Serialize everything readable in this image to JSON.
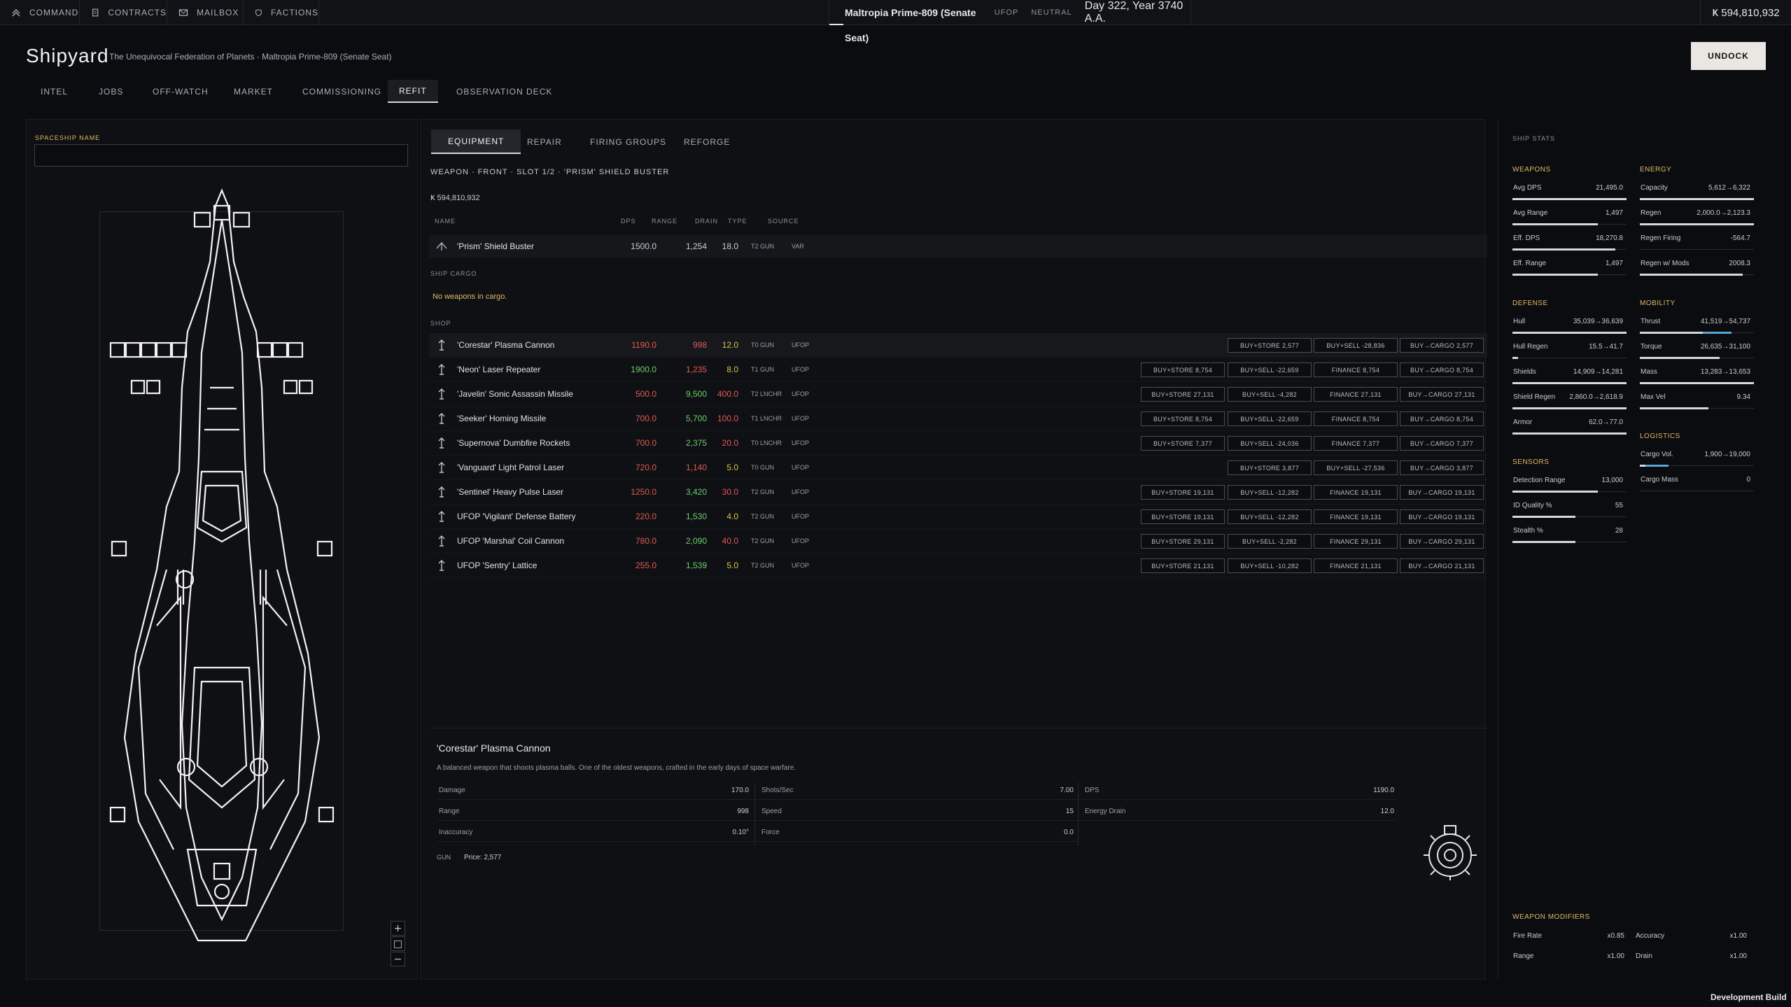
{
  "topbar": {
    "nav": [
      {
        "label": "COMMAND",
        "icon": "chevron-up-icon"
      },
      {
        "label": "CONTRACTS",
        "icon": "document-icon"
      },
      {
        "label": "MAILBOX",
        "icon": "mail-icon"
      },
      {
        "label": "FACTIONS",
        "icon": "shield-icon"
      }
    ],
    "location": "Maltropia Prime-809 (Senate Seat)",
    "faction_tag": "UFOP",
    "standing": "NEUTRAL",
    "date": "Day 322, Year 3740 A.A.",
    "credits": "Ҝ  594,810,932"
  },
  "header": {
    "title": "Shipyard",
    "subtitle": "The Unequivocal Federation of Planets  ·  Maltropia Prime-809 (Senate Seat)",
    "undock_label": "UNDOCK",
    "tabs": [
      "INTEL",
      "JOBS",
      "OFF-WATCH",
      "MARKET",
      "COMMISSIONING",
      "REFIT",
      "OBSERVATION DECK"
    ],
    "active_tab": "REFIT"
  },
  "left": {
    "ship_name_label": "SPACESHIP NAME",
    "ship_name_value": "",
    "ship_icon": "ship-schematic-icon",
    "zoom": [
      "+",
      "□",
      "−"
    ]
  },
  "middle": {
    "subtabs": [
      "EQUIPMENT",
      "REPAIR",
      "FIRING GROUPS",
      "REFORGE"
    ],
    "active_subtab": "EQUIPMENT",
    "breadcrumb": "WEAPON  ·  FRONT  ·  SLOT 1/2  ·  'PRISM' SHIELD BUSTER",
    "credits": "Ҝ  594,810,932",
    "columns": {
      "name": "NAME",
      "dps": "DPS",
      "range": "RANGE",
      "drain": "DRAIN",
      "type": "TYPE",
      "source": "SOURCE"
    },
    "equipped": {
      "name": "'Prism' Shield Buster",
      "dps": "1500.0",
      "range": "1,254",
      "drain": "18.0",
      "type": "T2 GUN",
      "source": "VAR"
    },
    "cargo_label": "SHIP CARGO",
    "cargo_empty": "No weapons in cargo.",
    "shop_label": "SHOP",
    "shop": [
      {
        "name": "'Corestar' Plasma Cannon",
        "dps": "1190.0",
        "dps_c": "red",
        "range": "998",
        "range_c": "red",
        "drain": "12.0",
        "drain_c": "green",
        "type": "T0 GUN",
        "source": "UFOP",
        "buttons": [
          "BUY+STORE 2,577",
          "BUY+SELL -28,836",
          "BUY→CARGO 2,577"
        ]
      },
      {
        "name": "'Neon' Laser Repeater",
        "dps": "1900.0",
        "dps_c": "green",
        "range": "1,235",
        "range_c": "red",
        "drain": "8.0",
        "drain_c": "green",
        "type": "T1 GUN",
        "source": "UFOP",
        "buttons": [
          "BUY+STORE 8,754",
          "BUY+SELL -22,659",
          "FINANCE 8,754",
          "BUY→CARGO 8,754"
        ]
      },
      {
        "name": "'Javelin' Sonic Assassin Missile",
        "dps": "500.0",
        "dps_c": "red",
        "range": "9,500",
        "range_c": "green",
        "drain": "400.0",
        "drain_c": "red",
        "type": "T2 LNCHR",
        "source": "UFOP",
        "buttons": [
          "BUY+STORE 27,131",
          "BUY+SELL -4,282",
          "FINANCE 27,131",
          "BUY→CARGO 27,131"
        ]
      },
      {
        "name": "'Seeker' Homing Missile",
        "dps": "700.0",
        "dps_c": "red",
        "range": "5,700",
        "range_c": "green",
        "drain": "100.0",
        "drain_c": "red",
        "type": "T1 LNCHR",
        "source": "UFOP",
        "buttons": [
          "BUY+STORE 8,754",
          "BUY+SELL -22,659",
          "FINANCE 8,754",
          "BUY→CARGO 8,754"
        ]
      },
      {
        "name": "'Supernova' Dumbfire Rockets",
        "dps": "700.0",
        "dps_c": "red",
        "range": "2,375",
        "range_c": "green",
        "drain": "20.0",
        "drain_c": "red",
        "type": "T0 LNCHR",
        "source": "UFOP",
        "buttons": [
          "BUY+STORE 7,377",
          "BUY+SELL -24,036",
          "FINANCE 7,377",
          "BUY→CARGO 7,377"
        ]
      },
      {
        "name": "'Vanguard' Light Patrol Laser",
        "dps": "720.0",
        "dps_c": "red",
        "range": "1,140",
        "range_c": "red",
        "drain": "5.0",
        "drain_c": "green",
        "type": "T0 GUN",
        "source": "UFOP",
        "buttons": [
          "BUY+STORE 3,877",
          "BUY+SELL -27,536",
          "BUY→CARGO 3,877"
        ]
      },
      {
        "name": "'Sentinel' Heavy Pulse Laser",
        "dps": "1250.0",
        "dps_c": "red",
        "range": "3,420",
        "range_c": "green",
        "drain": "30.0",
        "drain_c": "red",
        "type": "T2 GUN",
        "source": "UFOP",
        "buttons": [
          "BUY+STORE 19,131",
          "BUY+SELL -12,282",
          "FINANCE 19,131",
          "BUY→CARGO 19,131"
        ]
      },
      {
        "name": "UFOP 'Vigilant' Defense Battery",
        "dps": "220.0",
        "dps_c": "red",
        "range": "1,530",
        "range_c": "green",
        "drain": "4.0",
        "drain_c": "green",
        "type": "T2 GUN",
        "source": "UFOP",
        "buttons": [
          "BUY+STORE 19,131",
          "BUY+SELL -12,282",
          "FINANCE 19,131",
          "BUY→CARGO 19,131"
        ]
      },
      {
        "name": "UFOP 'Marshal' Coil Cannon",
        "dps": "780.0",
        "dps_c": "red",
        "range": "2,090",
        "range_c": "green",
        "drain": "40.0",
        "drain_c": "red",
        "type": "T2 GUN",
        "source": "UFOP",
        "buttons": [
          "BUY+STORE 29,131",
          "BUY+SELL -2,282",
          "FINANCE 29,131",
          "BUY→CARGO 29,131"
        ]
      },
      {
        "name": "UFOP 'Sentry' Lattice",
        "dps": "255.0",
        "dps_c": "red",
        "range": "1,539",
        "range_c": "green",
        "drain": "5.0",
        "drain_c": "green",
        "type": "T2 GUN",
        "source": "UFOP",
        "buttons": [
          "BUY+STORE 21,131",
          "BUY+SELL -10,282",
          "FINANCE 21,131",
          "BUY→CARGO 21,131"
        ]
      }
    ],
    "detail": {
      "name": "'Corestar' Plasma Cannon",
      "description": "A balanced weapon that shoots plasma balls. One of the oldest weapons, crafted in the early days of space warfare.",
      "col1": [
        {
          "l": "Damage",
          "v": "170.0"
        },
        {
          "l": "Range",
          "v": "998"
        },
        {
          "l": "Inaccuracy",
          "v": "0.10°"
        }
      ],
      "col2": [
        {
          "l": "Shots/Sec",
          "v": "7.00"
        },
        {
          "l": "Speed",
          "v": "15"
        },
        {
          "l": "Force",
          "v": "0.0"
        }
      ],
      "col3": [
        {
          "l": "DPS",
          "v": "1190.0"
        },
        {
          "l": "Energy Drain",
          "v": "12.0"
        }
      ],
      "category": "GUN",
      "price": "Price: 2,577",
      "icon": "plasma-cannon-icon"
    }
  },
  "right": {
    "title": "SHIP STATS",
    "weapons": {
      "head": "WEAPONS",
      "rows": [
        {
          "l": "Avg DPS",
          "v": "21,495.0",
          "f": 1.0
        },
        {
          "l": "Avg Range",
          "v": "1,497",
          "f": 0.75
        },
        {
          "l": "Eff. DPS",
          "v": "18,270.8",
          "f": 0.9
        },
        {
          "l": "Eff. Range",
          "v": "1,497",
          "f": 0.75
        }
      ]
    },
    "energy": {
      "head": "ENERGY",
      "rows": [
        {
          "l": "Capacity",
          "v": "5,612→6,322",
          "f": 1.0
        },
        {
          "l": "Regen",
          "v": "2,000.0→2,123.3",
          "f": 1.0
        },
        {
          "l": "Regen Firing",
          "v": "-564.7",
          "f": 0,
          "c": "red"
        },
        {
          "l": "Regen w/ Mods",
          "v": "2008.3",
          "f": 0.9
        }
      ]
    },
    "defense": {
      "head": "DEFENSE",
      "rows": [
        {
          "l": "Hull",
          "v": "35,039→36,639",
          "f": 1.0
        },
        {
          "l": "Hull Regen",
          "v": "15.5→41.7",
          "f": 0.05
        },
        {
          "l": "Shields",
          "v": "14,909→14,281",
          "f": 1.0
        },
        {
          "l": "Shield Regen",
          "v": "2,860.0→2,618.9",
          "f": 1.0
        },
        {
          "l": "Armor",
          "v": "62.0→77.0",
          "f": 1.0
        }
      ]
    },
    "mobility": {
      "head": "MOBILITY",
      "rows": [
        {
          "l": "Thrust",
          "v": "41,519→54,737",
          "f": 0.55,
          "f2": 0.25
        },
        {
          "l": "Torque",
          "v": "26,635→31,100",
          "f": 0.7
        },
        {
          "l": "Mass",
          "v": "13,283→13,653",
          "f": 1.0
        },
        {
          "l": "Max Vel",
          "v": "9.34",
          "f": 0.6
        }
      ]
    },
    "logistics": {
      "head": "LOGISTICS",
      "rows": [
        {
          "l": "Cargo Vol.",
          "v": "1,900→19,000",
          "f": 0.05,
          "f2": 0.2
        },
        {
          "l": "Cargo Mass",
          "v": "0",
          "f": 0
        }
      ]
    },
    "sensors": {
      "head": "SENSORS",
      "rows": [
        {
          "l": "Detection Range",
          "v": "13,000",
          "f": 0.75
        },
        {
          "l": "ID Quality %",
          "v": "55",
          "f": 0.55
        },
        {
          "l": "Stealth %",
          "v": "28",
          "f": 0.55
        }
      ]
    },
    "modifiers": {
      "head": "WEAPON MODIFIERS",
      "rows": [
        {
          "l": "Fire Rate",
          "v": "x0.85",
          "c": "blue"
        },
        {
          "l": "Accuracy",
          "v": "x1.00"
        },
        {
          "l": "Range",
          "v": "x1.00"
        },
        {
          "l": "Drain",
          "v": "x1.00"
        }
      ]
    }
  },
  "footer": {
    "build": "Development Build"
  }
}
